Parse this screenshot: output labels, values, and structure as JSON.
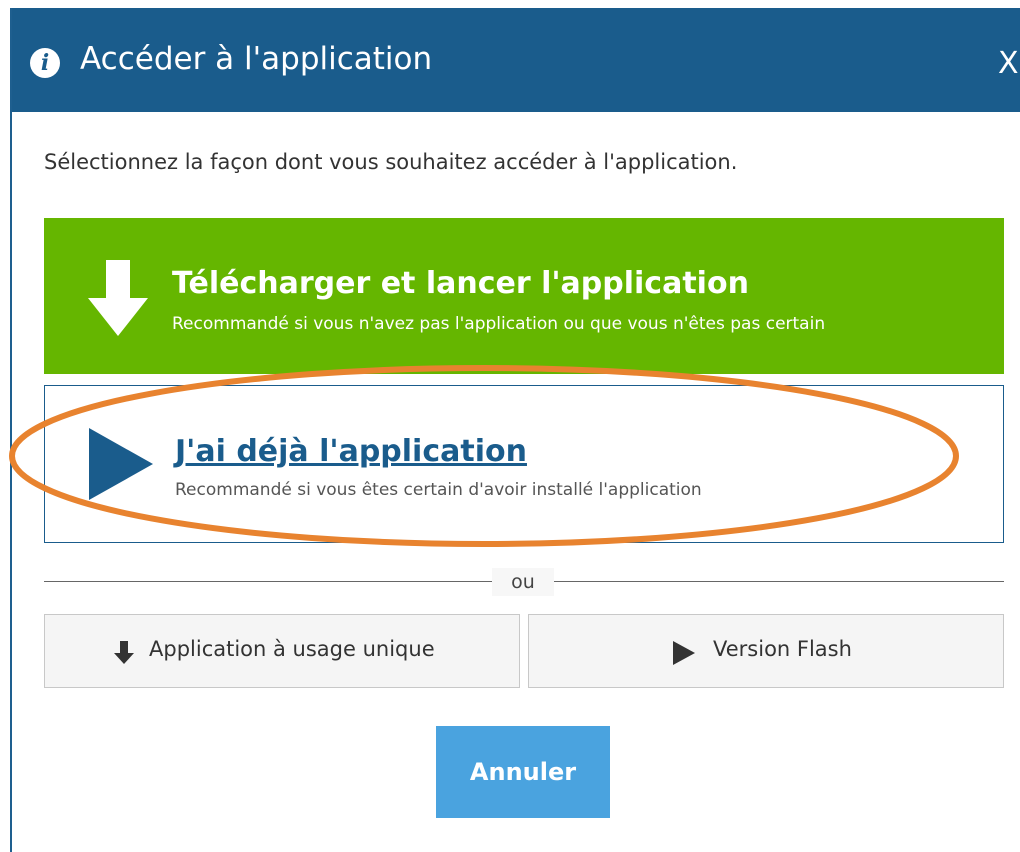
{
  "dialog": {
    "title": "Accéder à l'application",
    "close_label": "X",
    "info_icon_glyph": "i",
    "instruction": "Sélectionnez la façon dont vous souhaitez accéder à l'application."
  },
  "options": {
    "download": {
      "icon": "download-arrow-icon",
      "title": "Télécharger et lancer l'application",
      "subtitle": "Recommandé si vous n'avez pas l'application ou que vous n'êtes pas certain"
    },
    "existing": {
      "icon": "play-icon",
      "title": "J'ai déjà l'application",
      "subtitle": "Recommandé si vous êtes certain d'avoir installé l'application"
    }
  },
  "divider": {
    "label": "ou"
  },
  "alternatives": {
    "single_use": {
      "icon": "download-arrow-icon",
      "label": "Application à usage unique"
    },
    "flash": {
      "icon": "play-icon",
      "label": "Version Flash"
    }
  },
  "cancel_label": "Annuler",
  "colors": {
    "titlebar": "#1a5c8c",
    "download_green": "#65b600",
    "accent_blue": "#1a5c8c",
    "cancel_blue": "#4aa3df",
    "highlight_orange": "#e8832f"
  }
}
